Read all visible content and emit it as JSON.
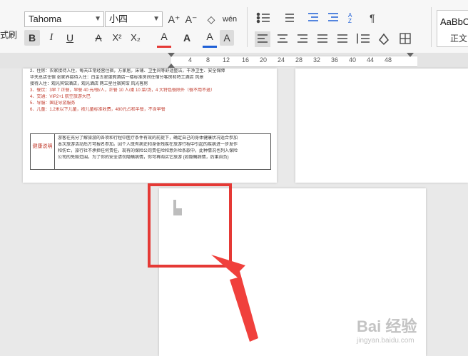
{
  "ribbon": {
    "left_cut_label": "式刷",
    "font_name": "Tahoma",
    "font_size": "小四",
    "buttons": {
      "grow_font": "A⁺",
      "shrink_font": "A⁻",
      "clear_format": "◇",
      "pinyin": "wén",
      "bold": "B",
      "italic": "I",
      "underline": "U",
      "strikethrough": "A",
      "superscript": "X²",
      "subscript": "X₂",
      "font_color": "A",
      "highlight": "A",
      "char_shading": "A"
    },
    "style_box": {
      "preview": "AaBbC",
      "name": "正文"
    }
  },
  "ruler": {
    "ticks": [
      "4",
      "8",
      "12",
      "16",
      "20",
      "24",
      "28",
      "32",
      "36",
      "40",
      "44",
      "48"
    ]
  },
  "page1": {
    "lines": [
      {
        "text": "2、住房：农家接待入住，每天正常经营住宿，方家居，床铺、卫生间等舒适整洁，干净卫生、安全保障",
        "red": false
      },
      {
        "text": "华天总店住宿     张家界接待入住：白金五星度假酒店一楼标准房间住宿分客房和特工酒店    风景",
        "red": false
      },
      {
        "text": "接待入住：观光宾馆酒店，观光酒店    两三星住宿宾馆    风光客房",
        "red": false
      },
      {
        "text": "3、餐饮：3早 7 正餐，早餐 40 元/餐/人，正餐 10 人/桌 10 菜/汤，4 大特色餐除外（餐不用不退）",
        "red": true
      },
      {
        "text": "4、交通：VIP2+1 航空旅游大巴",
        "red": true
      },
      {
        "text": "5、导服：国证导游服务",
        "red": true
      },
      {
        "text": "6、儿童：1.2米以下儿童，按儿童标准收费，480元占和半餐，不含早餐",
        "red": true
      }
    ],
    "health_label": "健康说明",
    "health_text": [
      "游客在充分了解旅游的各项和行程中医疗条件有效的前提下，确定自己的身体健康状况适合参加",
      "本次旅游活动后方可报名参加。因个人既有病史和身体残疾在旅游行程中引起的疾病进一步发作",
      "和伤亡，旅行社不承担任何责任，现有的保险公司责任险和意外险条款中，此种情况也列入保险",
      "公司的免赔范围。为了你的安全请勿隐瞒病情，你可再购买它旅游 (如隐瞒病情，后果自负)"
    ]
  },
  "watermark": {
    "main": "Bai 经验",
    "sub": "jingyan.baidu.com"
  },
  "colors": {
    "accent_red": "#e53935",
    "text_red": "#c0392b"
  }
}
